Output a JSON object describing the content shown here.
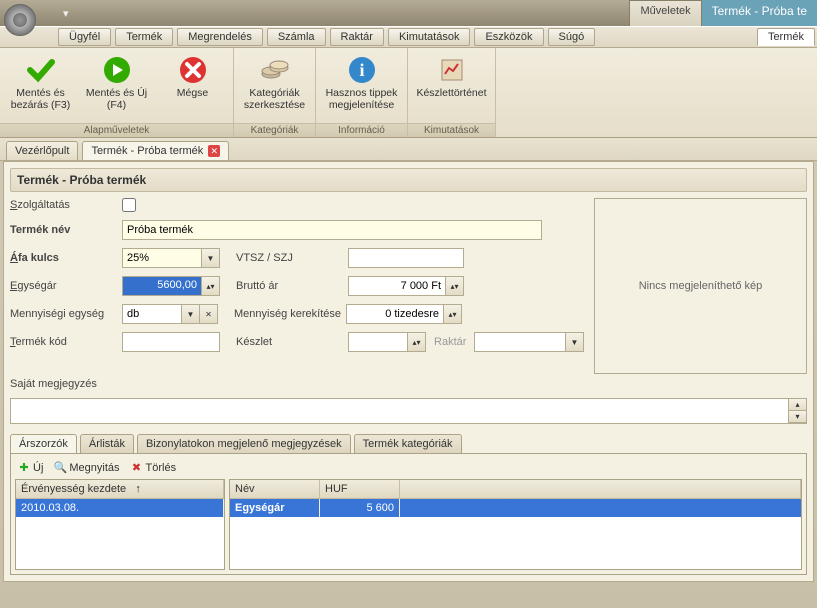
{
  "title": {
    "ops_tab": "Műveletek",
    "window": "Termék - Próba te"
  },
  "menu": [
    "Ügyfél",
    "Termék",
    "Megrendelés",
    "Számla",
    "Raktár",
    "Kimutatások",
    "Eszközök",
    "Súgó",
    "Termék"
  ],
  "ribbon": {
    "groups": [
      {
        "title": "Alapműveletek",
        "items": [
          {
            "label": "Mentés és bezárás (F3)",
            "icon": "check"
          },
          {
            "label": "Mentés és Új (F4)",
            "icon": "play"
          },
          {
            "label": "Mégse",
            "icon": "x"
          }
        ]
      },
      {
        "title": "Kategóriák",
        "items": [
          {
            "label": "Kategóriák szerkesztése",
            "icon": "coins"
          }
        ]
      },
      {
        "title": "Információ",
        "items": [
          {
            "label": "Hasznos tippek megjelenítése",
            "icon": "info"
          }
        ]
      },
      {
        "title": "Kimutatások",
        "items": [
          {
            "label": "Készlettörténet",
            "icon": "chart"
          }
        ]
      }
    ]
  },
  "doc_tabs": [
    {
      "label": "Vezérlőpult",
      "active": false,
      "close": false
    },
    {
      "label": "Termék - Próba termék",
      "active": true,
      "close": true
    }
  ],
  "form": {
    "title": "Termék - Próba termék",
    "labels": {
      "szolg": "Szolgáltatás",
      "nev": "Termék név",
      "afa": "Áfa kulcs",
      "afa_u": "Á",
      "vtsz": "VTSZ / SZJ",
      "egysegar": "Egységár",
      "egysegar_u": "E",
      "brutto": "Bruttó ár",
      "brutto_u": "B",
      "menny_e": "Mennyiségi egység",
      "menny_k": "Mennyiség kerekítése",
      "kod": "Termék kód",
      "kod_u": "T",
      "keszlet": "Készlet",
      "keszlet_u": "K",
      "raktar": "Raktár",
      "megj": "Saját megjegyzés"
    },
    "values": {
      "nev": "Próba termék",
      "afa": "25%",
      "egysegar": "5600,00",
      "brutto": "7 000 Ft",
      "menny_e": "db",
      "menny_k": "0 tizedesre",
      "kod": "",
      "keszlet": "",
      "raktar": "",
      "vtsz": ""
    },
    "img_placeholder": "Nincs megjeleníthető kép"
  },
  "bottom_tabs": [
    "Árszorzók",
    "Árlisták",
    "Bizonylatokon megjelenő megjegyzések",
    "Termék kategóriák"
  ],
  "toolbar": {
    "new": "Új",
    "open": "Megnyitás",
    "del": "Törlés"
  },
  "grid_left": {
    "hdr": "Érvényesség kezdete",
    "row": "2010.03.08."
  },
  "grid_right": {
    "hdr1": "Név",
    "hdr2": "HUF",
    "row1": "Egységár",
    "row2": "5 600"
  }
}
